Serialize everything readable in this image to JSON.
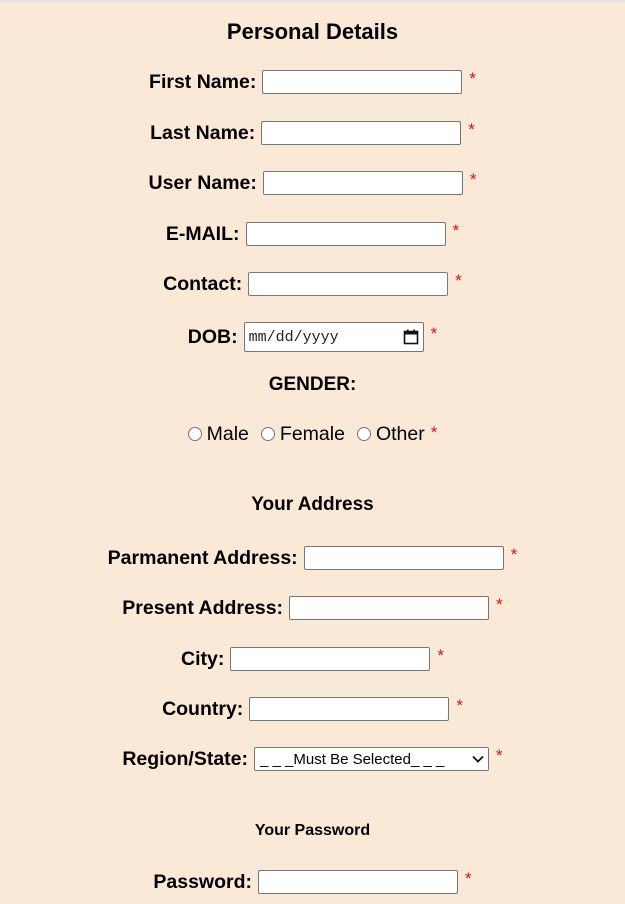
{
  "personal": {
    "title": "Personal Details",
    "first_name_label": "First Name:",
    "last_name_label": "Last Name:",
    "user_name_label": "User Name:",
    "email_label": "E-MAIL:",
    "contact_label": "Contact:",
    "dob_label": "DOB:",
    "dob_placeholder": "mm/dd/yyyy",
    "gender_label": "GENDER:",
    "gender_options": [
      "Male",
      "Female",
      "Other"
    ],
    "required_mark": "*"
  },
  "address": {
    "title": "Your Address",
    "permanent_label": "Parmanent Address:",
    "present_label": "Present Address:",
    "city_label": "City:",
    "country_label": "Country:",
    "region_label": "Region/State:",
    "region_selected": "_ _ _Must Be Selected_ _ _"
  },
  "password": {
    "title": "Your Password",
    "password_label": "Password:"
  },
  "icons": {
    "calendar": "calendar-icon",
    "dropdown": "chevron-down-icon"
  },
  "colors": {
    "background": "#fae9d7",
    "required": "#e01010"
  }
}
